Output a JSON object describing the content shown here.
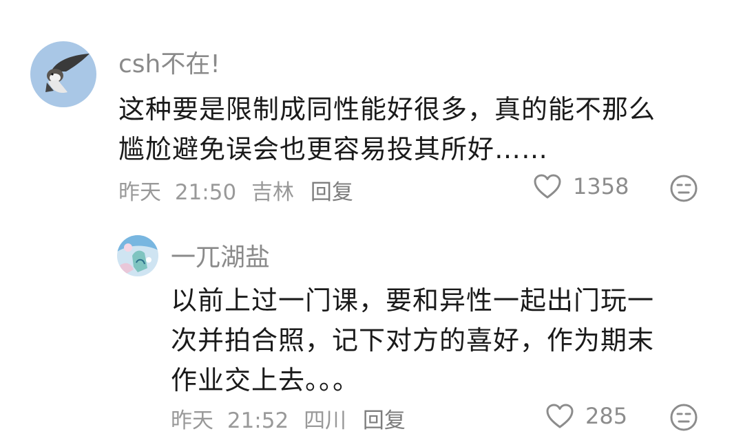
{
  "comments": [
    {
      "username": "csh不在!",
      "content_lines": [
        "这种要是限制成同性能好很多，真的能不那么",
        "尴尬避免误会也更容易投其所好……"
      ],
      "date": "昨天",
      "time": "21:50",
      "location": "吉林",
      "reply_label": "回复",
      "likes": "1358"
    },
    {
      "username": "一兀湖盐",
      "content_lines": [
        "以前上过一门课，要和异性一起出门玩一",
        "次并拍合照，记下对方的喜好，作为期末",
        "作业交上去。。。"
      ],
      "date": "昨天",
      "time": "21:52",
      "location": "四川",
      "reply_label": "回复",
      "likes": "285"
    }
  ],
  "icons": {
    "like": "heart-outline-icon",
    "react": "neutral-face-icon"
  },
  "colors": {
    "username": "#8a8a8a",
    "content": "#1a1a1a",
    "meta": "#999999",
    "avatar1_bg": "#a9c7e6",
    "avatar2_bg": "#cfe4f2"
  }
}
